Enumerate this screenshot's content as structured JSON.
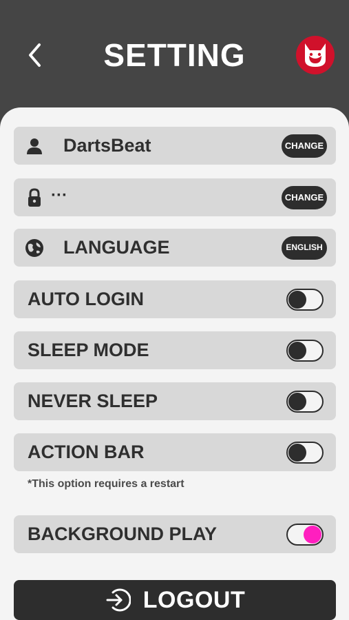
{
  "header": {
    "title": "SETTING",
    "back_icon": "chevron-left-icon",
    "logo_icon": "devil-mascot-logo"
  },
  "account": {
    "username": "DartsBeat",
    "username_button": "CHANGE",
    "password_masked": "···",
    "password_button": "CHANGE",
    "language_label": "LANGUAGE",
    "language_value": "ENGLISH"
  },
  "toggles": [
    {
      "label": "AUTO LOGIN",
      "on": false
    },
    {
      "label": "SLEEP MODE",
      "on": false
    },
    {
      "label": "NEVER SLEEP",
      "on": false
    },
    {
      "label": "ACTION BAR",
      "on": false
    },
    {
      "label": "BACKGROUND PLAY",
      "on": true
    }
  ],
  "restart_note": "*This option requires a restart",
  "logout": {
    "label": "LOGOUT",
    "icon": "logout-arrow-icon"
  },
  "colors": {
    "header_bg": "#454545",
    "panel_bg": "#f4f4f4",
    "row_bg": "#d8d8d8",
    "dark": "#2d2d2d",
    "toggle_on": "#ff1fbf",
    "brand_red": "#d0112b"
  }
}
